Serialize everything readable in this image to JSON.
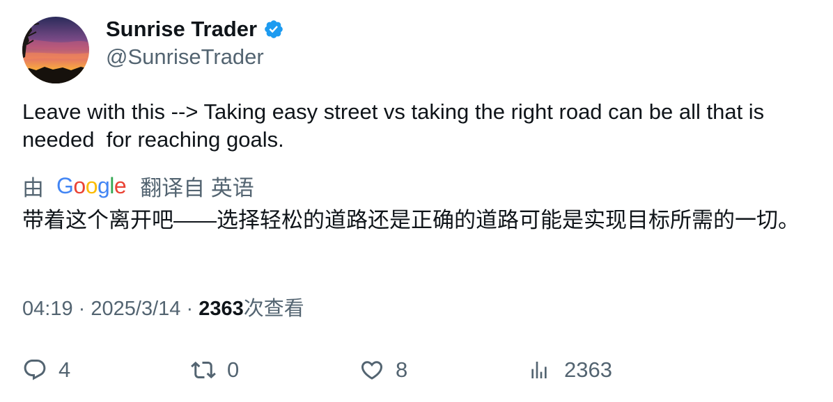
{
  "user": {
    "display_name": "Sunrise Trader",
    "handle": "@SunriseTrader",
    "verified": true,
    "avatar_icon": "sunset-avatar",
    "verified_color": "#1d9bf0"
  },
  "tweet": {
    "text": "Leave with this --> Taking easy street vs taking the right road can be all that is needed  for reaching goals."
  },
  "translation": {
    "prefix": "由",
    "provider_letters": [
      "G",
      "o",
      "o",
      "g",
      "l",
      "e"
    ],
    "suffix": "翻译自 英语",
    "text": "带着这个离开吧——选择轻松的道路还是正确的道路可能是实现目标所需的一切。"
  },
  "meta": {
    "time": "04:19",
    "separator": "·",
    "date": "2025/3/14",
    "views_count": "2363",
    "views_label": "次查看"
  },
  "actions": {
    "reply_count": "4",
    "retweet_count": "0",
    "like_count": "8",
    "views_count": "2363",
    "icon_color": "#536471"
  }
}
